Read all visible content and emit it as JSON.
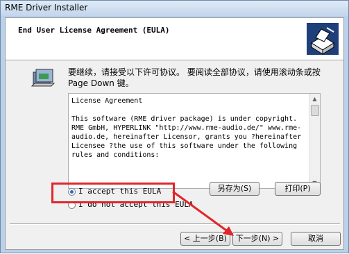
{
  "window": {
    "title": "RME Driver Installer"
  },
  "header": {
    "title": "End User License Agreement (EULA)",
    "icon": "installer-box-icon"
  },
  "instruction": "要继续，请接受以下许可协议。 要阅读全部协议，请使用滚动条或按 Page Down 键。",
  "eula": {
    "text": "License Agreement\n\nThis software (RME driver package) is under copyright. RME GmbH, HYPERLINK \"http://www.rme-audio.de/\" www.rme-audio.de, hereinafter Licensor, grants you ?hereinafter Licensee ?the use of this software under the following rules and conditions:"
  },
  "buttons": {
    "save_as": "另存为(S)",
    "print": "打印(P)",
    "back": "< 上一步(B)",
    "next": "下一步(N) >",
    "cancel": "取消"
  },
  "radios": {
    "accept": "I accept this EULA",
    "decline": "I do not accept this EULA",
    "selected": "accept"
  },
  "colors": {
    "highlight": "#e0262b",
    "accent": "#2a6cc4"
  }
}
